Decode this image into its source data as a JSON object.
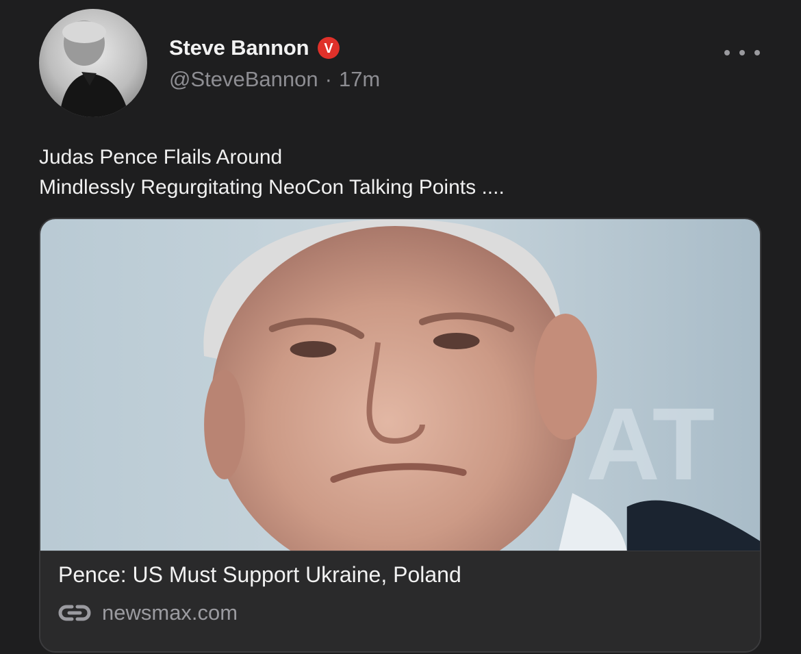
{
  "author": {
    "display_name": "Steve Bannon",
    "handle": "@SteveBannon",
    "separator": "·",
    "time": "17m",
    "badge_letter": "V",
    "badge_color": "#e0312a"
  },
  "post": {
    "lines": [
      "Judas Pence Flails Around",
      "Mindlessly Regurgitating NeoCon Talking Points ...."
    ]
  },
  "link_card": {
    "title": "Pence: US Must Support Ukraine, Poland",
    "domain": "newsmax.com",
    "domain_icon": "link-icon"
  },
  "icons": {
    "more": "more-options-icon",
    "verified": "verified-badge-icon"
  }
}
